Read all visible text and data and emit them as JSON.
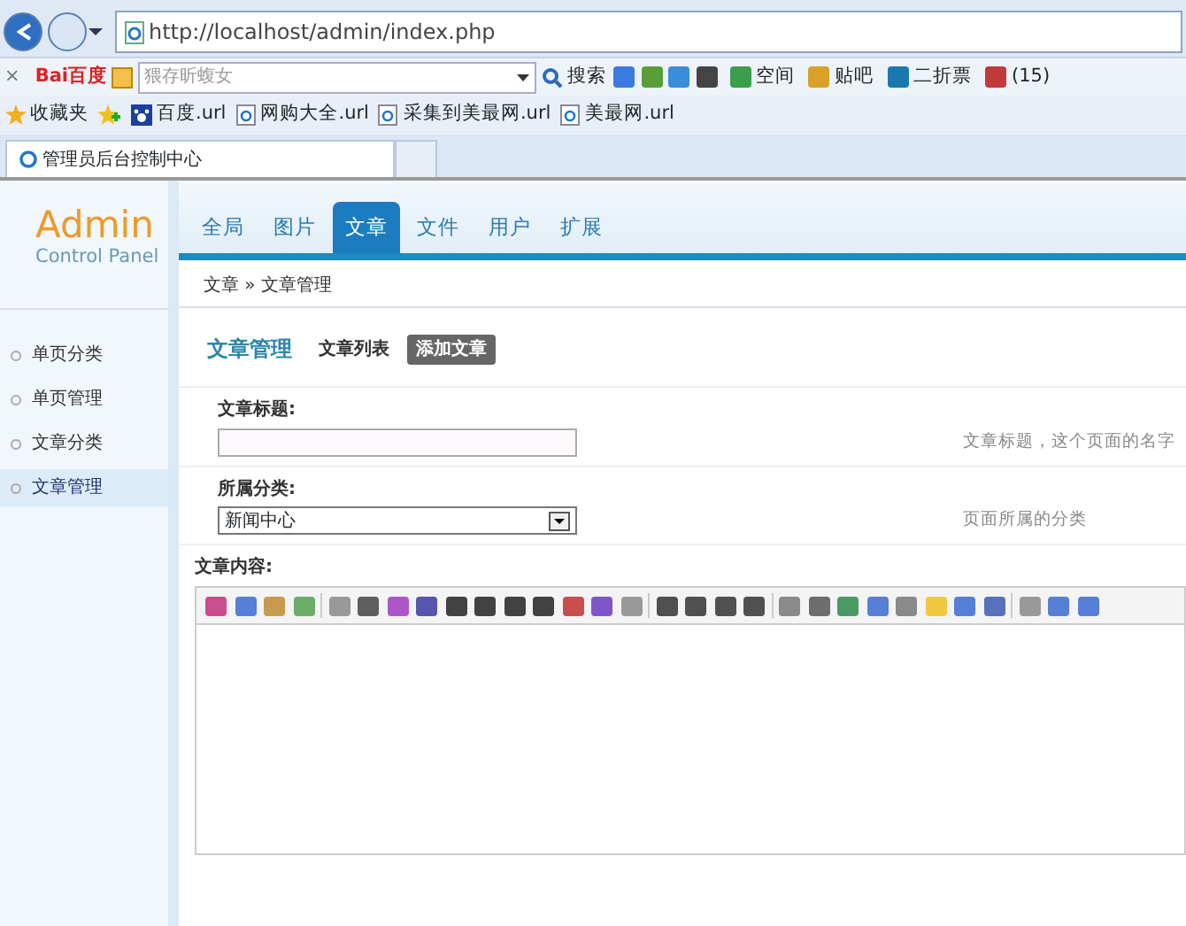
{
  "browser": {
    "address": "http://localhost/admin/index.php",
    "toolbar": {
      "close": "×",
      "logo": "Bai百度",
      "search_placeholder": "猥存昕蝮女",
      "search_button": "搜索",
      "buttons": [
        {
          "label": "空间"
        },
        {
          "label": "贴吧"
        },
        {
          "label": "二折票"
        },
        {
          "label": "(15)"
        }
      ]
    },
    "favorites": [
      {
        "label": "收藏夹",
        "kind": "star"
      },
      {
        "label": "百度.url",
        "kind": "paw"
      },
      {
        "label": "网购大全.url",
        "kind": "page"
      },
      {
        "label": "采集到美最网.url",
        "kind": "page"
      },
      {
        "label": "美最网.url",
        "kind": "page"
      }
    ],
    "tabs": [
      {
        "label": "管理员后台控制中心",
        "selected": true
      }
    ]
  },
  "logo": {
    "title": "Admin",
    "subtitle": "Control Panel"
  },
  "nav_tabs": [
    {
      "label": "全局",
      "selected": false
    },
    {
      "label": "图片",
      "selected": false
    },
    {
      "label": "文章",
      "selected": true
    },
    {
      "label": "文件",
      "selected": false
    },
    {
      "label": "用户",
      "selected": false
    },
    {
      "label": "扩展",
      "selected": false
    }
  ],
  "breadcrumb": "文章 » 文章管理",
  "sidebar": {
    "items": [
      {
        "label": "单页分类",
        "selected": false
      },
      {
        "label": "单页管理",
        "selected": false
      },
      {
        "label": "文章分类",
        "selected": false
      },
      {
        "label": "文章管理",
        "selected": true
      }
    ]
  },
  "content": {
    "title": "文章管理",
    "actions": [
      {
        "label": "文章列表",
        "selected": false
      },
      {
        "label": "添加文章",
        "selected": true
      }
    ],
    "fields": [
      {
        "label": "文章标题:",
        "kind": "text",
        "hint": "文章标题，这个页面的名字"
      },
      {
        "label": "所属分类:",
        "kind": "select",
        "value": "新闻中心",
        "hint": "页面所属的分类"
      },
      {
        "label": "文章内容:",
        "kind": "editor"
      }
    ]
  }
}
